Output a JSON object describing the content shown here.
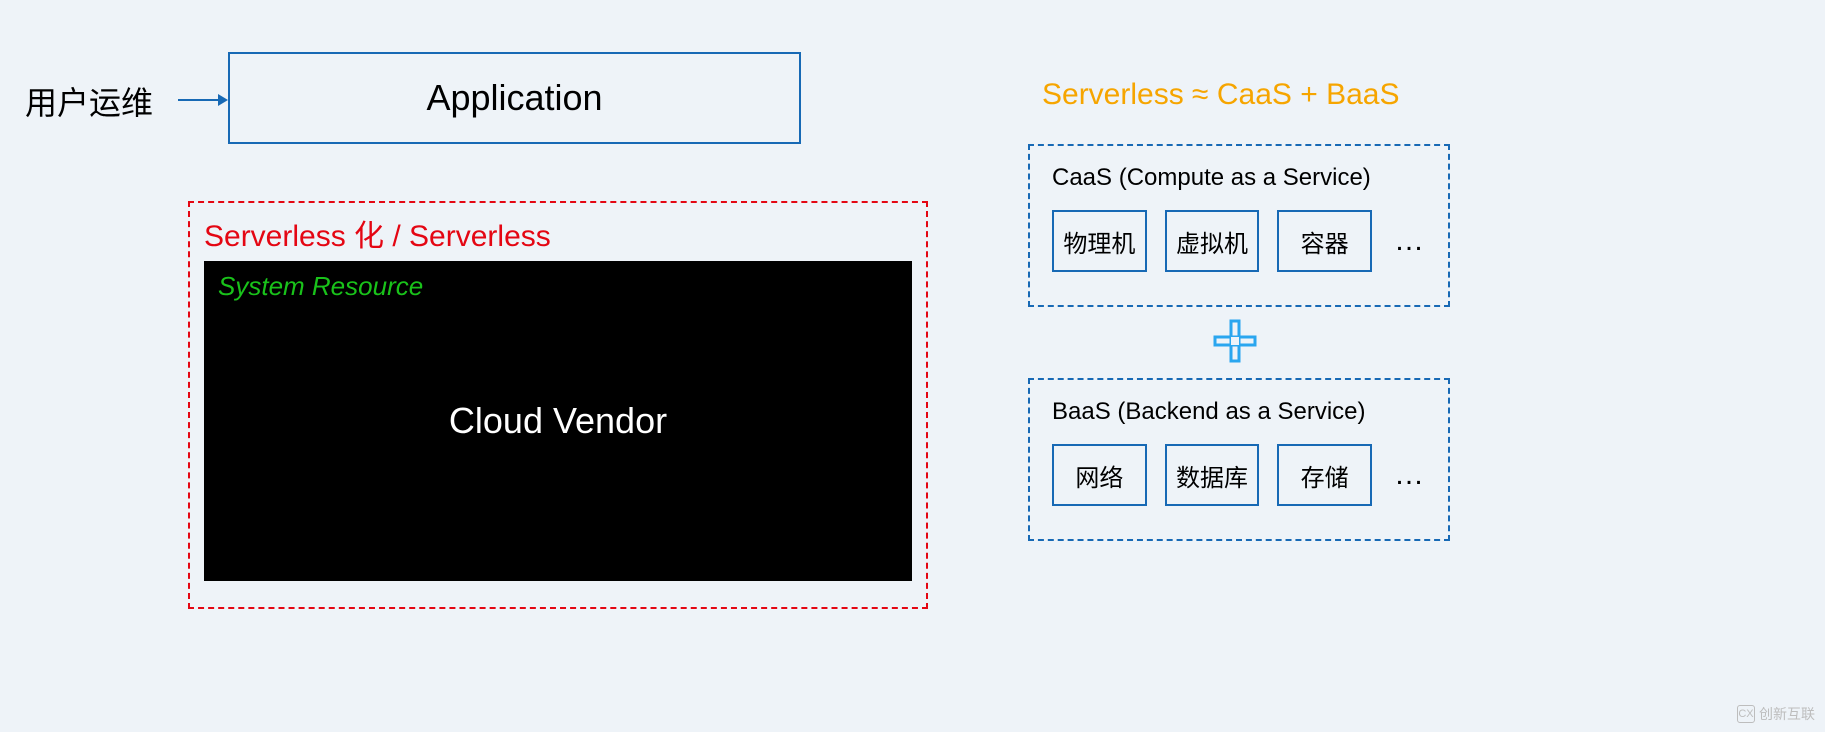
{
  "left": {
    "user_ops": "用户运维",
    "application": "Application",
    "serverless_title": "Serverless 化 / Serverless",
    "system_resource": "System Resource",
    "cloud_vendor": "Cloud Vendor"
  },
  "right": {
    "formula": "Serverless ≈ CaaS + BaaS",
    "caas": {
      "title": "CaaS (Compute as a Service)",
      "items": [
        "物理机",
        "虚拟机",
        "容器"
      ],
      "more": "…"
    },
    "baas": {
      "title": "BaaS (Backend as a Service)",
      "items": [
        "网络",
        "数据库",
        "存储"
      ],
      "more": "…"
    }
  },
  "watermark": "创新互联"
}
